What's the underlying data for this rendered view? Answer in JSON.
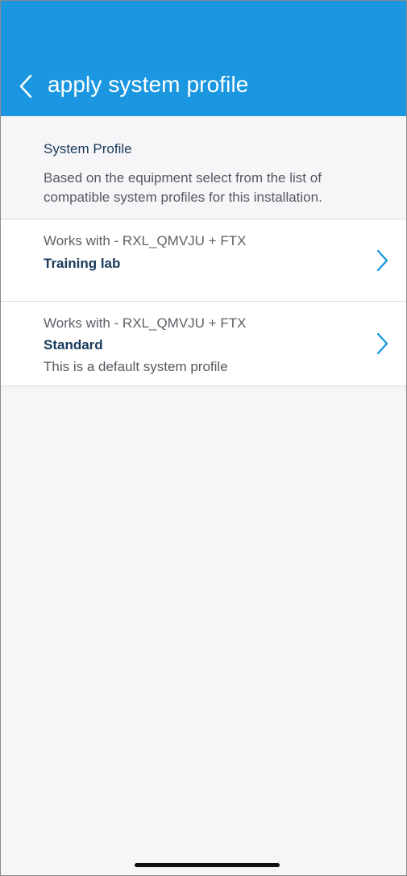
{
  "header": {
    "title": "apply system profile",
    "back_icon": "chevron-left-icon",
    "background_color": "#1a97e0"
  },
  "section": {
    "title": "System Profile",
    "description": "Based on the equipment select from the list of compatible system profiles for this installation."
  },
  "profiles": [
    {
      "works_with": "Works with - RXL_QMVJU + FTX",
      "name": "Training lab",
      "note": "",
      "chevron_icon": "chevron-right-icon"
    },
    {
      "works_with": "Works with - RXL_QMVJU + FTX",
      "name": "Standard",
      "note": "This is a default system profile",
      "chevron_icon": "chevron-right-icon"
    }
  ],
  "colors": {
    "accent": "#1a97e0",
    "text_dark": "#183b5a",
    "text_muted": "#555a60",
    "page_background": "#f6f5f7"
  }
}
